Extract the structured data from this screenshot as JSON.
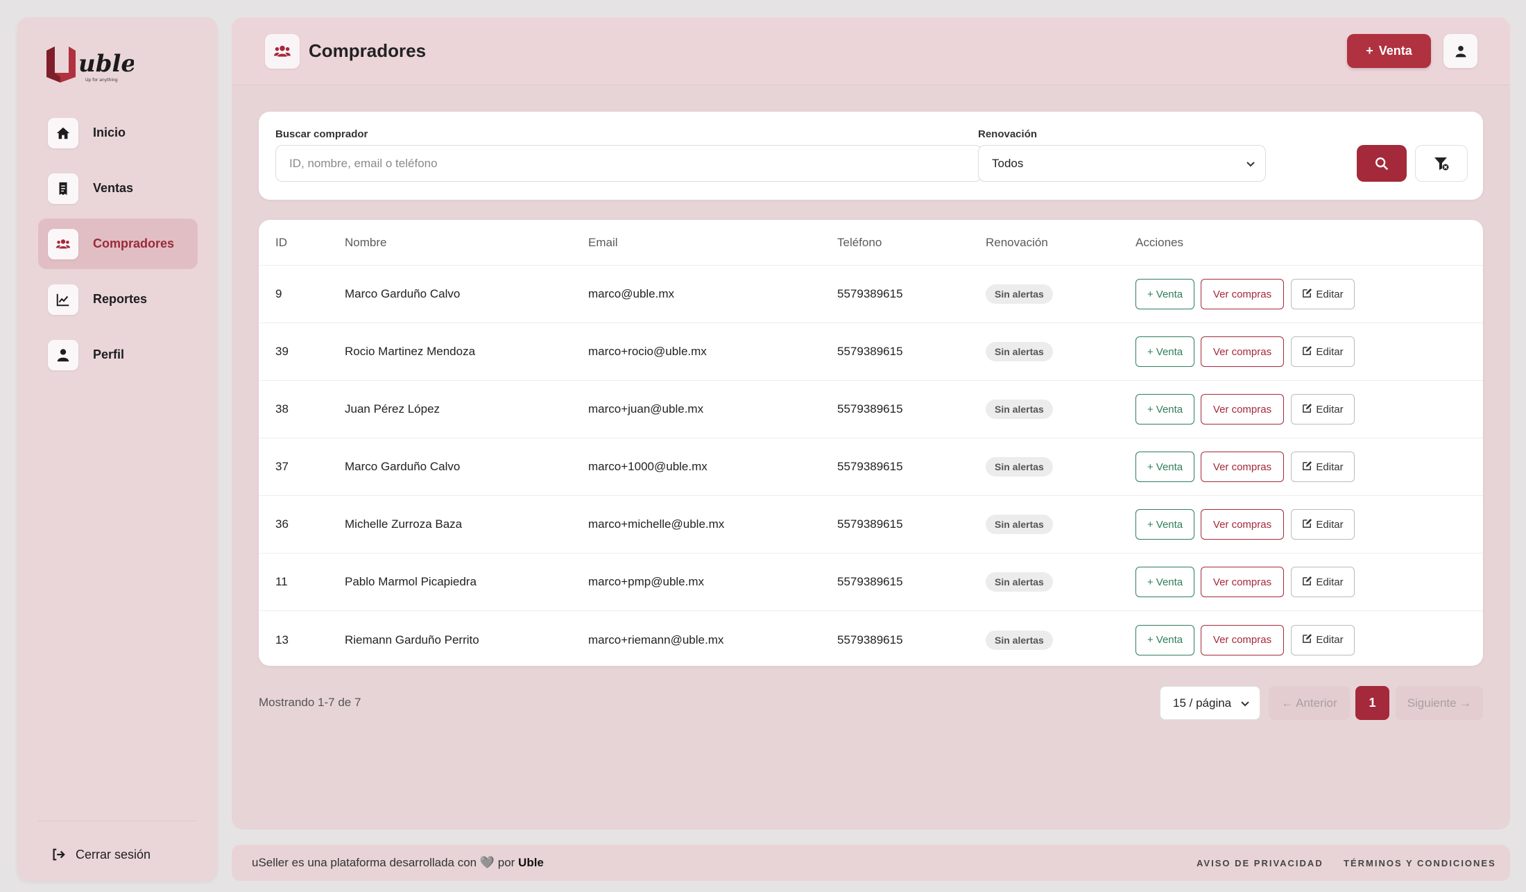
{
  "brand": {
    "logo_text": "uble",
    "logo_tagline": "Up for anything"
  },
  "sidebar": {
    "items": [
      {
        "label": "Inicio",
        "icon": "home-icon"
      },
      {
        "label": "Ventas",
        "icon": "receipt-icon"
      },
      {
        "label": "Compradores",
        "icon": "users-icon",
        "active": true
      },
      {
        "label": "Reportes",
        "icon": "chart-line-icon"
      },
      {
        "label": "Perfil",
        "icon": "user-icon"
      }
    ],
    "logout_label": "Cerrar sesión"
  },
  "header": {
    "title": "Compradores",
    "new_sale_label": "Venta"
  },
  "filters": {
    "search_label": "Buscar comprador",
    "search_placeholder": "ID, nombre, email o teléfono",
    "search_value": "",
    "renewal_label": "Renovación",
    "renewal_value": "Todos"
  },
  "table": {
    "columns": [
      "ID",
      "Nombre",
      "Email",
      "Teléfono",
      "Renovación",
      "Acciones"
    ],
    "rows": [
      {
        "id": "9",
        "name": "Marco Garduño Calvo",
        "email": "marco@uble.mx",
        "phone": "5579389615",
        "renewal": "Sin alertas"
      },
      {
        "id": "39",
        "name": "Rocio Martinez Mendoza",
        "email": "marco+rocio@uble.mx",
        "phone": "5579389615",
        "renewal": "Sin alertas"
      },
      {
        "id": "38",
        "name": "Juan Pérez López",
        "email": "marco+juan@uble.mx",
        "phone": "5579389615",
        "renewal": "Sin alertas"
      },
      {
        "id": "37",
        "name": "Marco Garduño Calvo",
        "email": "marco+1000@uble.mx",
        "phone": "5579389615",
        "renewal": "Sin alertas"
      },
      {
        "id": "36",
        "name": "Michelle Zurroza Baza",
        "email": "marco+michelle@uble.mx",
        "phone": "5579389615",
        "renewal": "Sin alertas"
      },
      {
        "id": "11",
        "name": "Pablo Marmol Picapiedra",
        "email": "marco+pmp@uble.mx",
        "phone": "5579389615",
        "renewal": "Sin alertas"
      },
      {
        "id": "13",
        "name": "Riemann Garduño Perrito",
        "email": "marco+riemann@uble.mx",
        "phone": "5579389615",
        "renewal": "Sin alertas"
      }
    ],
    "actions": {
      "venta": "+ Venta",
      "ver_compras": "Ver compras",
      "editar": "Editar"
    }
  },
  "pagination": {
    "showing": "Mostrando 1-7 de 7",
    "per_page": "15 / página",
    "prev": "← Anterior",
    "current": "1",
    "next": "Siguiente →"
  },
  "footer": {
    "text_prefix": "uSeller es una plataforma desarrollada con 🩶 por ",
    "text_brand": "Uble",
    "privacy": "AVISO DE PRIVACIDAD",
    "terms": "TÉRMINOS Y CONDICIONES"
  },
  "colors": {
    "accent": "#a4293a",
    "success": "#2e7d5a",
    "sidebar_bg": "#ead6d9",
    "main_bg": "#e7d4d7"
  }
}
